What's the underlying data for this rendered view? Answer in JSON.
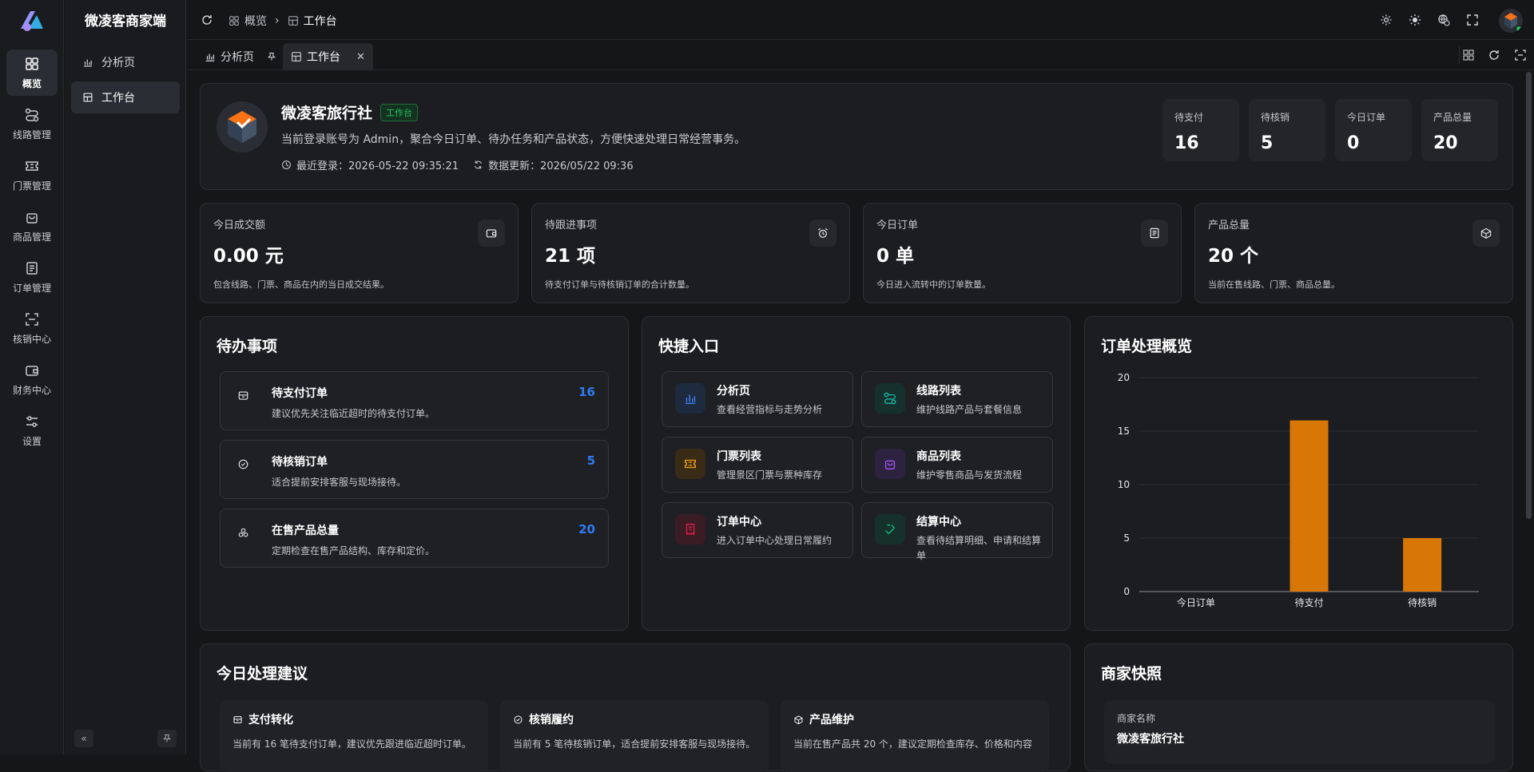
{
  "app": {
    "brand": "微凌客商家端"
  },
  "rail": [
    {
      "label": "概览",
      "icon": "grid-icon",
      "active": true
    },
    {
      "label": "线路管理",
      "icon": "route-icon"
    },
    {
      "label": "门票管理",
      "icon": "ticket-icon"
    },
    {
      "label": "商品管理",
      "icon": "bag-icon"
    },
    {
      "label": "订单管理",
      "icon": "document-icon"
    },
    {
      "label": "核销中心",
      "icon": "scan-icon"
    },
    {
      "label": "财务中心",
      "icon": "wallet-icon"
    },
    {
      "label": "设置",
      "icon": "sliders-icon"
    }
  ],
  "side": [
    {
      "label": "分析页",
      "icon": "bar-chart-icon"
    },
    {
      "label": "工作台",
      "icon": "workbench-icon",
      "active": true
    }
  ],
  "breadcrumb": [
    "概览",
    "工作台"
  ],
  "tabs": [
    {
      "label": "分析页",
      "icon": "bar-chart-icon",
      "pinned": true
    },
    {
      "label": "工作台",
      "icon": "workbench-icon",
      "active": true,
      "closable": true
    }
  ],
  "header": {
    "name": "微凌客旅行社",
    "badge": "工作台",
    "badge_color": "#22c55e",
    "desc": "当前登录账号为 Admin，聚合今日订单、待办任务和产品状态，方便快速处理日常经营事务。",
    "last_login": "最近登录：2026-05-22 09:35:21",
    "data_update": "数据更新：2026/05/22 09:36",
    "mini": [
      {
        "label": "待支付",
        "value": "16"
      },
      {
        "label": "待核销",
        "value": "5"
      },
      {
        "label": "今日订单",
        "value": "0"
      },
      {
        "label": "产品总量",
        "value": "20"
      }
    ]
  },
  "stats": [
    {
      "label": "今日成交额",
      "value": "0.00 元",
      "desc": "包含线路、门票、商品在内的当日成交结果。",
      "icon": "wallet-icon"
    },
    {
      "label": "待跟进事项",
      "value": "21 项",
      "desc": "待支付订单与待核销订单的合计数量。",
      "icon": "alarm-icon"
    },
    {
      "label": "今日订单",
      "value": "0 单",
      "desc": "今日进入流转中的订单数量。",
      "icon": "document-icon"
    },
    {
      "label": "产品总量",
      "value": "20 个",
      "desc": "当前在售线路、门票、商品总量。",
      "icon": "box-icon"
    }
  ],
  "todo": {
    "title": "待办事项",
    "items": [
      {
        "title": "待支付订单",
        "desc": "建议优先关注临近超时的待支付订单。",
        "count": "16",
        "icon": "inbox-icon"
      },
      {
        "title": "待核销订单",
        "desc": "适合提前安排客服与现场接待。",
        "count": "5",
        "icon": "check-circle-icon"
      },
      {
        "title": "在售产品总量",
        "desc": "定期检查在售产品结构、库存和定价。",
        "count": "20",
        "icon": "cubes-icon"
      }
    ]
  },
  "quick": {
    "title": "快捷入口",
    "items": [
      {
        "title": "分析页",
        "desc": "查看经营指标与走势分析",
        "icon": "bar-chart-icon",
        "color": "#3b82f6",
        "bg": "#1e2a3d"
      },
      {
        "title": "线路列表",
        "desc": "维护线路产品与套餐信息",
        "icon": "route-icon",
        "color": "#14b8a6",
        "bg": "#16302d"
      },
      {
        "title": "门票列表",
        "desc": "管理景区门票与票种库存",
        "icon": "ticket-icon",
        "color": "#f59e0b",
        "bg": "#3a2b17"
      },
      {
        "title": "商品列表",
        "desc": "维护零售商品与发货流程",
        "icon": "bag-icon",
        "color": "#a855f7",
        "bg": "#2d2240"
      },
      {
        "title": "订单中心",
        "desc": "进入订单中心处理日常履约",
        "icon": "receipt-icon",
        "color": "#e11d48",
        "bg": "#3a1c24"
      },
      {
        "title": "结算中心",
        "desc": "查看待结算明细、申请和结算单",
        "icon": "settle-icon",
        "color": "#10b981",
        "bg": "#16302a"
      }
    ]
  },
  "overview": {
    "title": "订单处理概览"
  },
  "chart_data": {
    "type": "bar",
    "categories": [
      "今日订单",
      "待支付",
      "待核销"
    ],
    "values": [
      0,
      16,
      5
    ],
    "ylim": [
      0,
      20
    ],
    "yticks": [
      0,
      5,
      10,
      15,
      20
    ],
    "grid": true,
    "color": "#d97706"
  },
  "suggest": {
    "title": "今日处理建议",
    "items": [
      {
        "title": "支付转化",
        "desc": "当前有 16 笔待支付订单，建议优先跟进临近超时订单。",
        "icon": "inbox-icon"
      },
      {
        "title": "核销履约",
        "desc": "当前有 5 笔待核销订单，适合提前安排客服与现场接待。",
        "icon": "check-circle-icon"
      },
      {
        "title": "产品维护",
        "desc": "当前在售产品共 20 个，建议定期检查库存、价格和内容",
        "icon": "box-icon"
      }
    ]
  },
  "merchant": {
    "title": "商家快照",
    "field_label": "商家名称",
    "field_value": "微凌客旅行社"
  }
}
